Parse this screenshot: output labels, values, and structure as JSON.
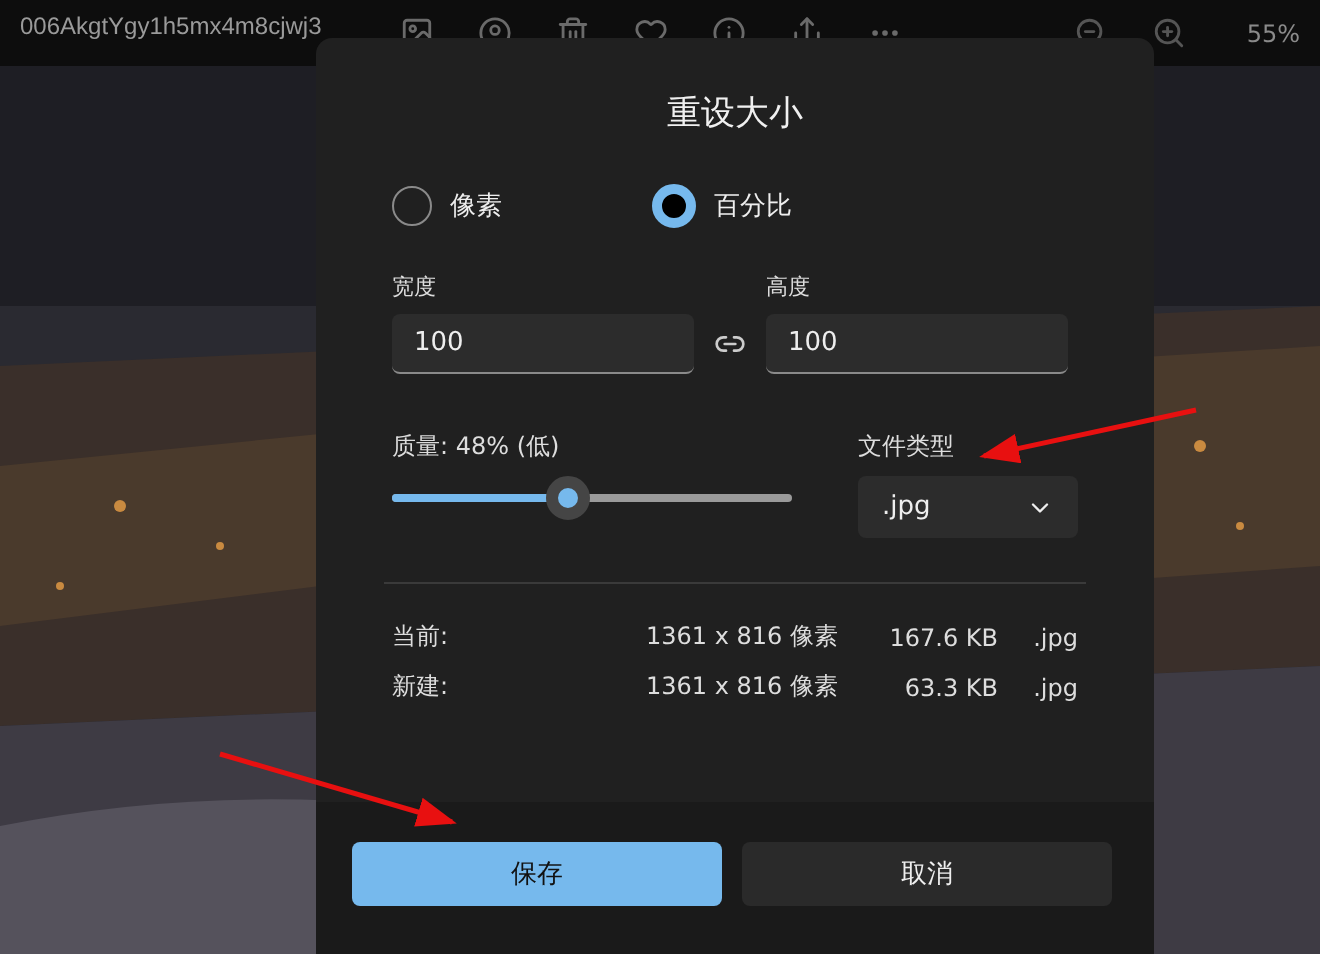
{
  "viewer": {
    "file_name": "006AkgtYgy1h5mx4m8cjwj3",
    "zoom": "55%"
  },
  "dialog": {
    "title": "重设大小",
    "modes": [
      {
        "label": "像素",
        "selected": false
      },
      {
        "label": "百分比",
        "selected": true
      }
    ],
    "width": {
      "label": "宽度",
      "value": "100"
    },
    "height": {
      "label": "高度",
      "value": "100"
    },
    "quality": {
      "label": "质量: 48% (低)",
      "level": 0.44
    },
    "file_type": {
      "label": "文件类型",
      "value": ".jpg"
    },
    "info_rows": [
      {
        "label": "当前:",
        "dimensions": "1361 x 816 像素",
        "size": "167.6 KB",
        "format": ".jpg"
      },
      {
        "label": "新建:",
        "dimensions": "1361 x 816 像素",
        "size": "63.3 KB",
        "format": ".jpg"
      }
    ],
    "buttons": [
      {
        "label": "保存",
        "kind": "primary"
      },
      {
        "label": "取消",
        "kind": "secondary"
      }
    ]
  }
}
